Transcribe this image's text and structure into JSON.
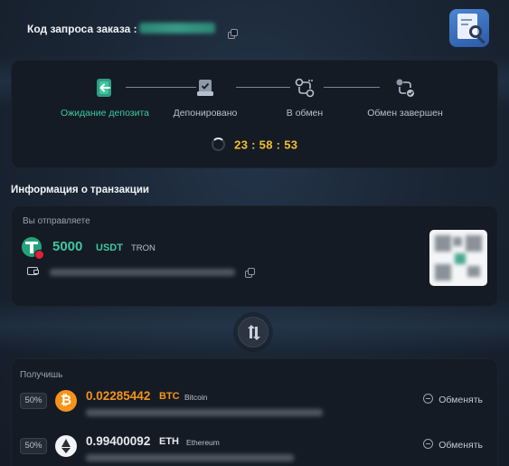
{
  "order": {
    "label": "Код запроса заказа :"
  },
  "progress": {
    "steps": [
      {
        "label": "Ожидание депозита",
        "state": "active"
      },
      {
        "label": "Депонировано",
        "state": "pending"
      },
      {
        "label": "В обмен",
        "state": "pending"
      },
      {
        "label": "Обмен завершен",
        "state": "pending"
      }
    ],
    "timer": "23 : 58 : 53"
  },
  "transaction": {
    "title": "Информация о транзакции",
    "send": {
      "label": "Вы отправляете",
      "amount": "5000",
      "ticker": "USDT",
      "network": "TRON"
    },
    "receive": {
      "label": "Получишь",
      "items": [
        {
          "percent": "50%",
          "amount": "0.02285442",
          "ticker": "BTC",
          "name": "Bitcoin",
          "action": "Обменять",
          "color": "#f7931a"
        },
        {
          "percent": "50%",
          "amount": "0.99400092",
          "ticker": "ETH",
          "name": "Ethereum",
          "action": "Обменять",
          "color": "#e6ebf0"
        }
      ]
    }
  },
  "colors": {
    "accent": "#3fc7a2",
    "timer": "#f3c12e",
    "btc": "#f7931a",
    "card": "#141b24"
  }
}
